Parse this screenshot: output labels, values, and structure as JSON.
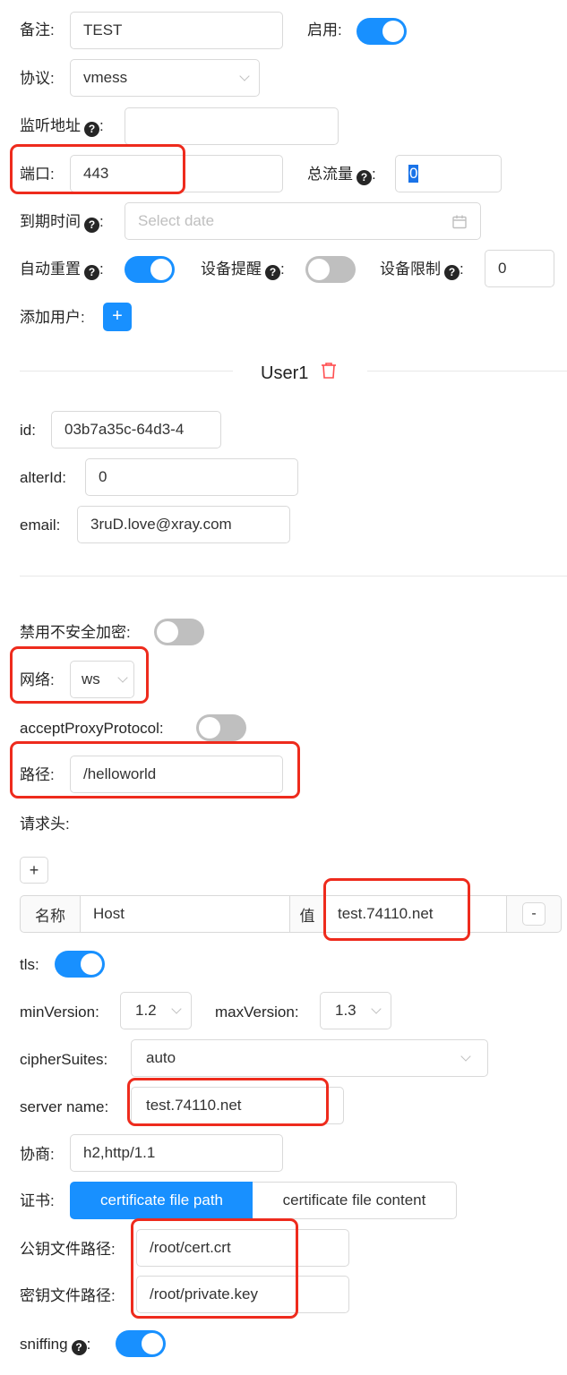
{
  "general": {
    "remark_label": "备注:",
    "remark_value": "TEST",
    "enable_label": "启用:",
    "enable_on": true,
    "protocol_label": "协议:",
    "protocol_value": "vmess",
    "listen_label": "监听地址",
    "listen_value": "",
    "port_label": "端口:",
    "port_value": "443",
    "total_traffic_label": "总流量",
    "total_traffic_value": "0",
    "expiry_label": "到期时间",
    "expiry_placeholder": "Select date",
    "auto_reset_label": "自动重置",
    "device_alert_label": "设备提醒",
    "device_limit_label": "设备限制",
    "device_limit_value": "0",
    "add_user_label": "添加用户:",
    "add_symbol": "+",
    "colon": ":",
    "help_symbol": "?"
  },
  "user": {
    "title": "User1",
    "id_label": "id:",
    "id_value": "03b7a35c-64d3-4",
    "alterid_label": "alterId:",
    "alterid_value": "0",
    "email_label": "email:",
    "email_value": "3ruD.love@xray.com"
  },
  "transport": {
    "disable_insecure_label": "禁用不安全加密:",
    "network_label": "网络:",
    "network_value": "ws",
    "accept_proxy_label": "acceptProxyProtocol:",
    "path_label": "路径:",
    "path_value": "/helloworld",
    "headers_label": "请求头:",
    "add_header_symbol": "+",
    "header_name_addon": "名称",
    "header_name_value": "Host",
    "header_value_addon": "值",
    "header_value_value": "test.74110.net",
    "remove_header_symbol": "-"
  },
  "tls": {
    "tls_label": "tls:",
    "minversion_label": "minVersion:",
    "minversion_value": "1.2",
    "maxversion_label": "maxVersion:",
    "maxversion_value": "1.3",
    "ciphersuites_label": "cipherSuites:",
    "ciphersuites_value": "auto",
    "servername_label": "server name:",
    "servername_value": "test.74110.net",
    "alpn_label": "协商:",
    "alpn_value": "h2,http/1.1",
    "cert_label": "证书:",
    "cert_tabs": [
      "certificate file path",
      "certificate file content"
    ],
    "pubkey_label": "公钥文件路径:",
    "pubkey_value": "/root/cert.crt",
    "privkey_label": "密钥文件路径:",
    "privkey_value": "/root/private.key",
    "sniffing_label": "sniffing"
  },
  "colors": {
    "accent": "#1890ff",
    "highlight": "#ee2b1d",
    "danger": "#ff4d4f"
  }
}
